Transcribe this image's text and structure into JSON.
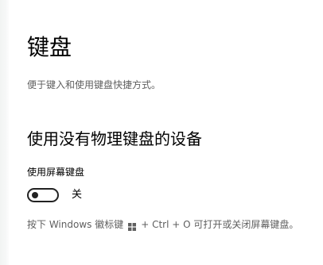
{
  "page": {
    "title": "键盘",
    "description": "便于键入和使用键盘快捷方式。"
  },
  "section": {
    "heading": "使用没有物理键盘的设备"
  },
  "on_screen_keyboard": {
    "label": "使用屏幕键盘",
    "toggle_state_text": "关",
    "enabled": false
  },
  "hint": {
    "before": "按下 Windows 徽标键",
    "icon": "windows-logo-icon",
    "after": "+ Ctrl + O 可打开或关闭屏幕键盘。"
  }
}
